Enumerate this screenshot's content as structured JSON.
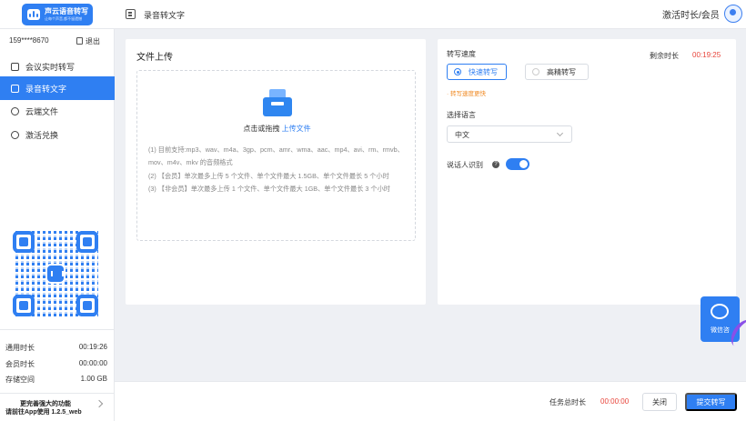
{
  "header": {
    "app_name": "声云语音转写",
    "app_tagline": "让每个声音,都不留遗憾",
    "page_title": "录音转文字",
    "member_link": "激活时长/会员"
  },
  "sidebar": {
    "phone": "159****8670",
    "logout": "退出",
    "items": [
      {
        "label": "会议实时转写",
        "icon": "monitor-icon"
      },
      {
        "label": "录音转文字",
        "icon": "document-icon",
        "active": true
      },
      {
        "label": "云端文件",
        "icon": "cloud-icon"
      },
      {
        "label": "激活兑换",
        "icon": "gift-icon"
      }
    ],
    "stats": [
      {
        "label": "通用时长",
        "value": "00:19:26"
      },
      {
        "label": "会员时长",
        "value": "00:00:00"
      },
      {
        "label": "存储空间",
        "value": "1.00 GB"
      }
    ],
    "promo_line1": "更完善强大的功能",
    "promo_line2": "请前往App使用 1.2.5_web"
  },
  "upload": {
    "title": "文件上传",
    "drop_text": "点击或拖拽",
    "drop_link": "上传文件",
    "notes": [
      "(1) 目前支持:mp3、wav、m4a、3gp、pcm、amr、wma、aac、mp4、avi、rm、rmvb、mov、m4v、mkv 的音频格式",
      "(2) 【会员】单次最多上传 5 个文件、单个文件最大 1.5GB、单个文件最长 5 个小时",
      "(3) 【非会员】单次最多上传 1 个文件、单个文件最大 1GB、单个文件最长 3 个小时"
    ]
  },
  "settings": {
    "speed_label": "转写速度",
    "remain_label": "剩余时长",
    "remain_value": "00:19:25",
    "speed_options": [
      "快速转写",
      "高精转写"
    ],
    "speed_tip": "· 转写速度更快",
    "language_label": "选择语言",
    "language_value": "中文",
    "speaker_label": "说话人识别",
    "speaker_enabled": true
  },
  "float": {
    "wechat_label": "微信咨"
  },
  "footer": {
    "total_label": "任务总时长",
    "total_value": "00:00:00",
    "close_label": "关闭",
    "submit_label": "提交转写"
  },
  "colors": {
    "accent": "#2f7ff2",
    "warning": "#f08a24",
    "danger": "#e8443a"
  }
}
